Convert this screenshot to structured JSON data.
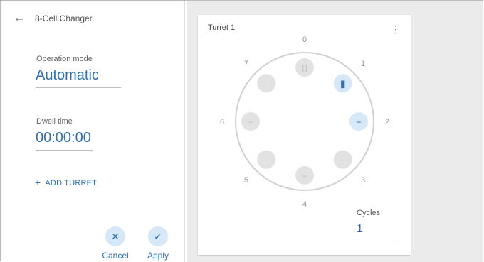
{
  "header": {
    "title": "8-Cell Changer"
  },
  "operation_mode": {
    "label": "Operation mode",
    "value": "Automatic"
  },
  "dwell_time": {
    "label": "Dwell time",
    "value": "00:00:00"
  },
  "add_turret": {
    "plus": "+",
    "label": "ADD TURRET"
  },
  "actions": {
    "cancel": {
      "icon": "✕",
      "label": "Cancel"
    },
    "apply": {
      "icon": "✓",
      "label": "Apply"
    }
  },
  "turret": {
    "title": "Turret 1",
    "positions": [
      "0",
      "1",
      "2",
      "3",
      "4",
      "5",
      "6",
      "7"
    ],
    "cells": [
      {
        "id": 0,
        "symbol": "▯",
        "state": "present"
      },
      {
        "id": 1,
        "symbol": "▮",
        "state": "selected"
      },
      {
        "id": 2,
        "symbol": "−",
        "state": "active"
      },
      {
        "id": 3,
        "symbol": "−",
        "state": "empty"
      },
      {
        "id": 4,
        "symbol": "−",
        "state": "empty"
      },
      {
        "id": 5,
        "symbol": "−",
        "state": "empty"
      },
      {
        "id": 6,
        "symbol": "−",
        "state": "empty"
      },
      {
        "id": 7,
        "symbol": "−",
        "state": "empty"
      }
    ]
  },
  "cycles": {
    "label": "Cycles",
    "value": "1"
  },
  "colors": {
    "accent": "#2f6fad",
    "accent_light": "#d6e7f7",
    "neutral_fill": "#e2e2e2",
    "panel_bg": "#ebebeb"
  }
}
